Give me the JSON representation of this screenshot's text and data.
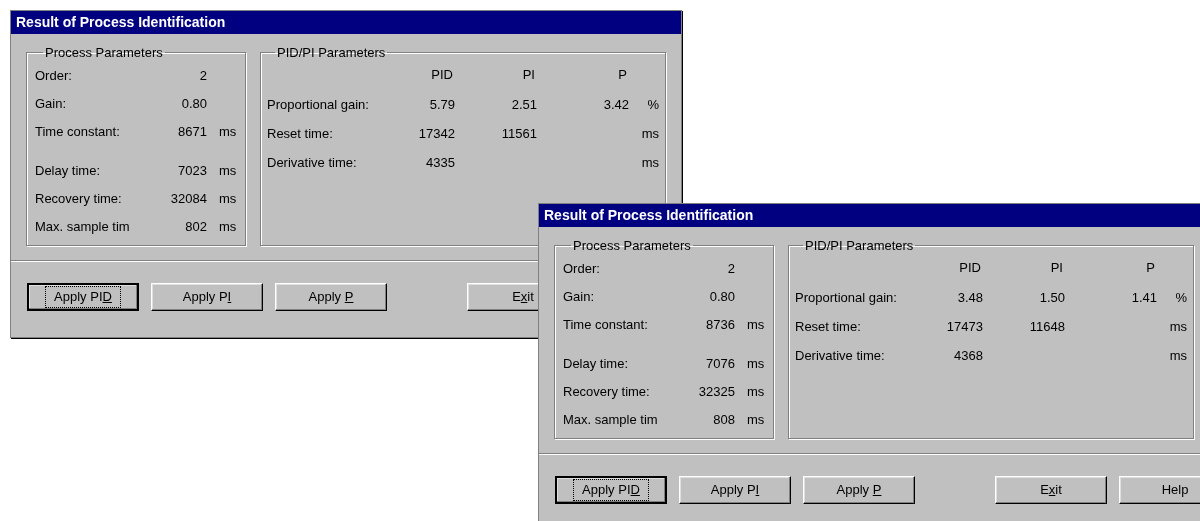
{
  "windows": [
    {
      "title": "Result of Process Identification",
      "process_parameters": {
        "title": "Process Parameters",
        "rows": [
          {
            "label": "Order:",
            "value": "2"
          },
          {
            "label": "Gain:",
            "value": "0.80"
          },
          {
            "label": "Time constant:",
            "value": "8671",
            "unit": "ms"
          },
          {
            "label": "Delay time:",
            "value": "7023",
            "unit": "ms"
          },
          {
            "label": "Recovery time:",
            "value": "32084",
            "unit": "ms"
          },
          {
            "label": "Max. sample tim",
            "value": "802",
            "unit": "ms"
          }
        ]
      },
      "pid_parameters": {
        "title": "PID/PI Parameters",
        "columns": [
          "PID",
          "PI",
          "P"
        ],
        "rows": [
          {
            "label": "Proportional gain:",
            "values": [
              "5.79",
              "2.51",
              "3.42"
            ],
            "unit": "%"
          },
          {
            "label": "Reset time:",
            "values": [
              "17342",
              "11561"
            ],
            "unit": "ms"
          },
          {
            "label": "Derivative time:",
            "values": [
              "4335"
            ],
            "unit": "ms"
          }
        ]
      },
      "buttons": [
        {
          "pre": "Apply PI",
          "key": "D",
          "focused": true
        },
        {
          "pre": "Apply P",
          "key": "I",
          "focused": false
        },
        {
          "pre": "Apply ",
          "key": "P",
          "focused": false
        },
        {
          "pre": "E",
          "key": "x",
          "post": "it",
          "focused": false,
          "spaced": true
        }
      ]
    },
    {
      "title": "Result of Process Identification",
      "process_parameters": {
        "title": "Process Parameters",
        "rows": [
          {
            "label": "Order:",
            "value": "2"
          },
          {
            "label": "Gain:",
            "value": "0.80"
          },
          {
            "label": "Time constant:",
            "value": "8736",
            "unit": "ms"
          },
          {
            "label": "Delay time:",
            "value": "7076",
            "unit": "ms"
          },
          {
            "label": "Recovery time:",
            "value": "32325",
            "unit": "ms"
          },
          {
            "label": "Max. sample tim",
            "value": "808",
            "unit": "ms"
          }
        ]
      },
      "pid_parameters": {
        "title": "PID/PI Parameters",
        "columns": [
          "PID",
          "PI",
          "P"
        ],
        "rows": [
          {
            "label": "Proportional gain:",
            "values": [
              "3.48",
              "1.50",
              "1.41"
            ],
            "unit": "%"
          },
          {
            "label": "Reset time:",
            "values": [
              "17473",
              "11648"
            ],
            "unit": "ms"
          },
          {
            "label": "Derivative time:",
            "values": [
              "4368"
            ],
            "unit": "ms"
          }
        ]
      },
      "buttons": [
        {
          "pre": "Apply PI",
          "key": "D",
          "focused": true
        },
        {
          "pre": "Apply P",
          "key": "I",
          "focused": false
        },
        {
          "pre": "Apply ",
          "key": "P",
          "focused": false
        },
        {
          "pre": "E",
          "key": "x",
          "post": "it",
          "focused": false,
          "spaced": true
        },
        {
          "pre": "Help",
          "focused": false
        }
      ]
    }
  ]
}
